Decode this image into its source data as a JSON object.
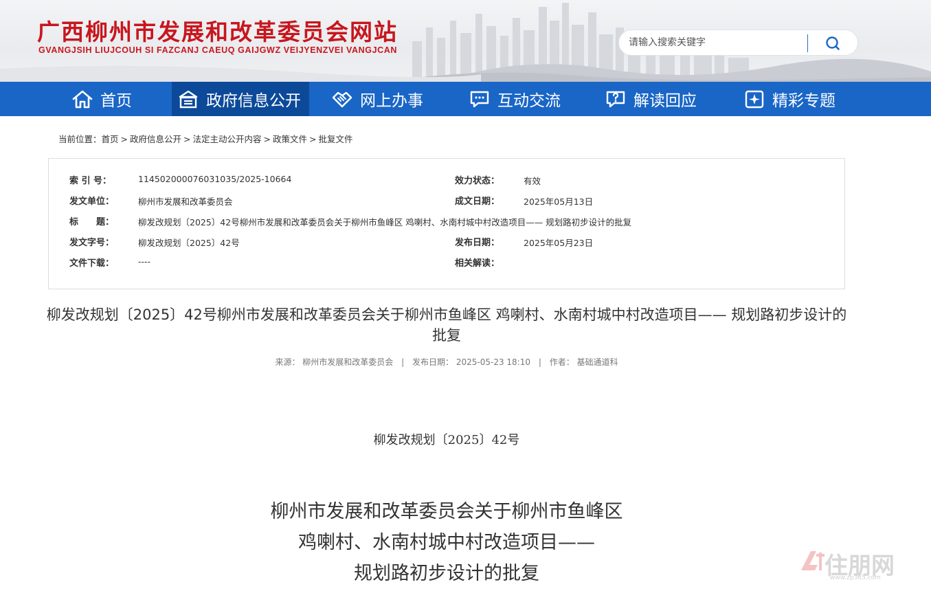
{
  "header": {
    "title": "广西柳州市发展和改革委员会网站",
    "subtitle": "GVANGJSIH LIUJCOUH SI FAZCANJ CAEUQ GAIJGWZ VEIJYENZVEI VANGJCAN",
    "search_placeholder": "请输入搜索关键字"
  },
  "nav": {
    "items": [
      {
        "label": "首页",
        "icon": "home-icon",
        "active": false
      },
      {
        "label": "政府信息公开",
        "icon": "building-icon",
        "active": true
      },
      {
        "label": "网上办事",
        "icon": "handshake-icon",
        "active": false
      },
      {
        "label": "互动交流",
        "icon": "chat-icon",
        "active": false
      },
      {
        "label": "解读回应",
        "icon": "question-chat-icon",
        "active": false
      },
      {
        "label": "精彩专题",
        "icon": "sparkle-icon",
        "active": false
      }
    ]
  },
  "breadcrumb": {
    "prefix": "当前位置：",
    "items": [
      "首页",
      "政府信息公开",
      "法定主动公开内容",
      "政策文件",
      "批复文件"
    ],
    "separator": ">"
  },
  "info": {
    "index_label": "索 引 号：",
    "index_value": "114502000076031035/2025-10664",
    "status_label": "效力状态：",
    "status_value": "有效",
    "issuer_label": "发文单位：",
    "issuer_value": "柳州市发展和改革委员会",
    "date_label": "成文日期：",
    "date_value": "2025年05月13日",
    "title_label": "标　　题：",
    "title_value": "柳发改规划〔2025〕42号柳州市发展和改革委员会关于柳州市鱼峰区 鸡喇村、水南村城中村改造项目—— 规划路初步设计的批复",
    "docno_label": "发文字号：",
    "docno_value": "柳发改规划〔2025〕42号",
    "publish_label": "发布日期：",
    "publish_value": "2025年05月23日",
    "download_label": "文件下载：",
    "download_value": "----",
    "related_label": "相关解读："
  },
  "article": {
    "title": "柳发改规划〔2025〕42号柳州市发展和改革委员会关于柳州市鱼峰区 鸡喇村、水南村城中村改造项目—— 规划路初步设计的批复",
    "source_label": "来源：",
    "source_value": "柳州市发展和改革委员会",
    "date_label": "发布日期：",
    "date_value": "2025-05-23 18:10",
    "author_label": "作者：",
    "author_value": "基础通道科",
    "doc_number": "柳发改规划〔2025〕42号",
    "heading_line1": "柳州市发展和改革委员会关于柳州市鱼峰区",
    "heading_line2": "鸡喇村、水南村城中村改造项目——",
    "heading_line3": "规划路初步设计的批复"
  },
  "watermark": {
    "logo_text": "住朋网",
    "logo_url": "www.zp365.com"
  },
  "colors": {
    "brand_red": "#c8161d",
    "nav_blue": "#1a66c7",
    "nav_active": "#0c4a99"
  }
}
